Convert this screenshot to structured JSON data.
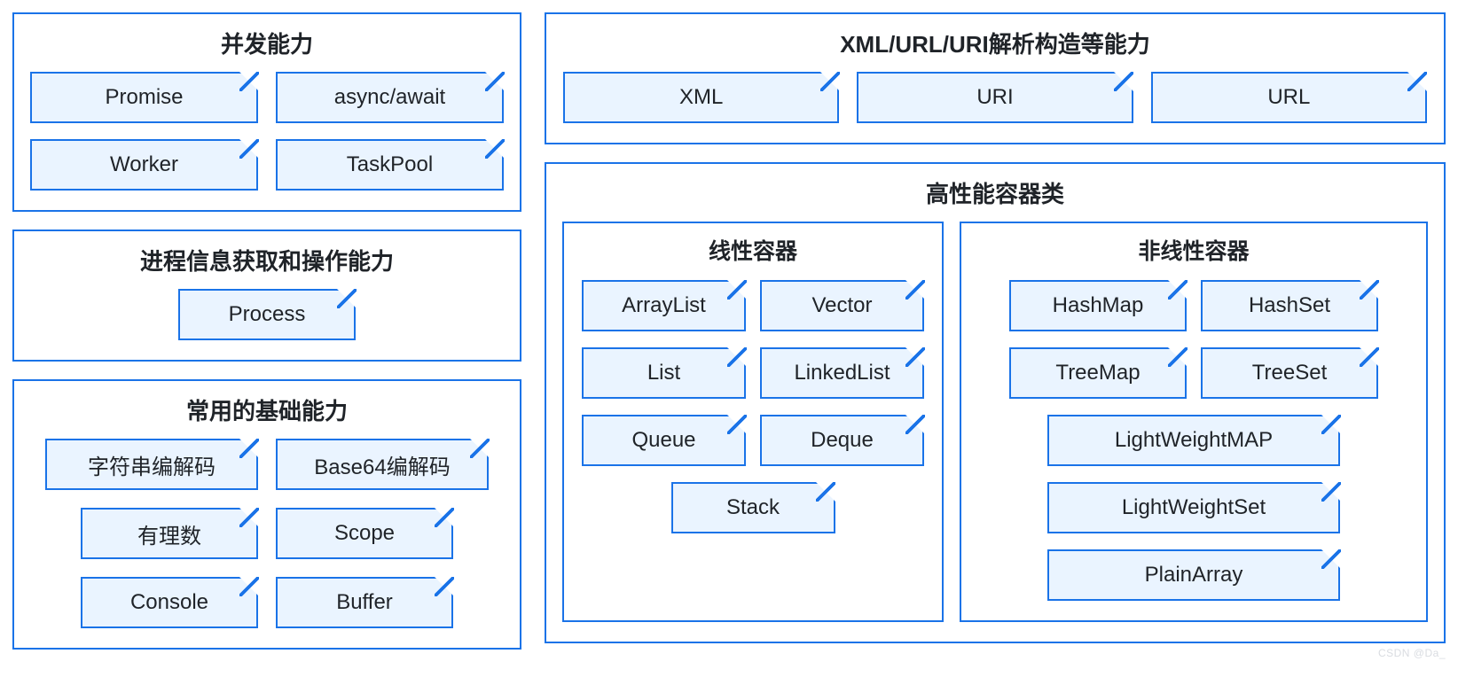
{
  "left": {
    "concurrency": {
      "title": "并发能力",
      "items": [
        "Promise",
        "async/await",
        "Worker",
        "TaskPool"
      ]
    },
    "process": {
      "title": "进程信息获取和操作能力",
      "items": [
        "Process"
      ]
    },
    "basic": {
      "title": "常用的基础能力",
      "rows": [
        [
          "字符串编解码",
          "Base64编解码"
        ],
        [
          "有理数",
          "Scope"
        ],
        [
          "Console",
          "Buffer"
        ]
      ]
    }
  },
  "right": {
    "parse": {
      "title": "XML/URL/URI解析构造等能力",
      "items": [
        "XML",
        "URI",
        "URL"
      ]
    },
    "containers": {
      "title": "高性能容器类",
      "linear": {
        "title": "线性容器",
        "rows": [
          [
            "ArrayList",
            "Vector"
          ],
          [
            "List",
            "LinkedList"
          ],
          [
            "Queue",
            "Deque"
          ],
          [
            "Stack"
          ]
        ]
      },
      "nonlinear": {
        "title": "非线性容器",
        "pairs": [
          [
            "HashMap",
            "HashSet"
          ],
          [
            "TreeMap",
            "TreeSet"
          ]
        ],
        "singles": [
          "LightWeightMAP",
          "LightWeightSet",
          "PlainArray"
        ]
      }
    }
  },
  "watermark": "CSDN @Da_"
}
